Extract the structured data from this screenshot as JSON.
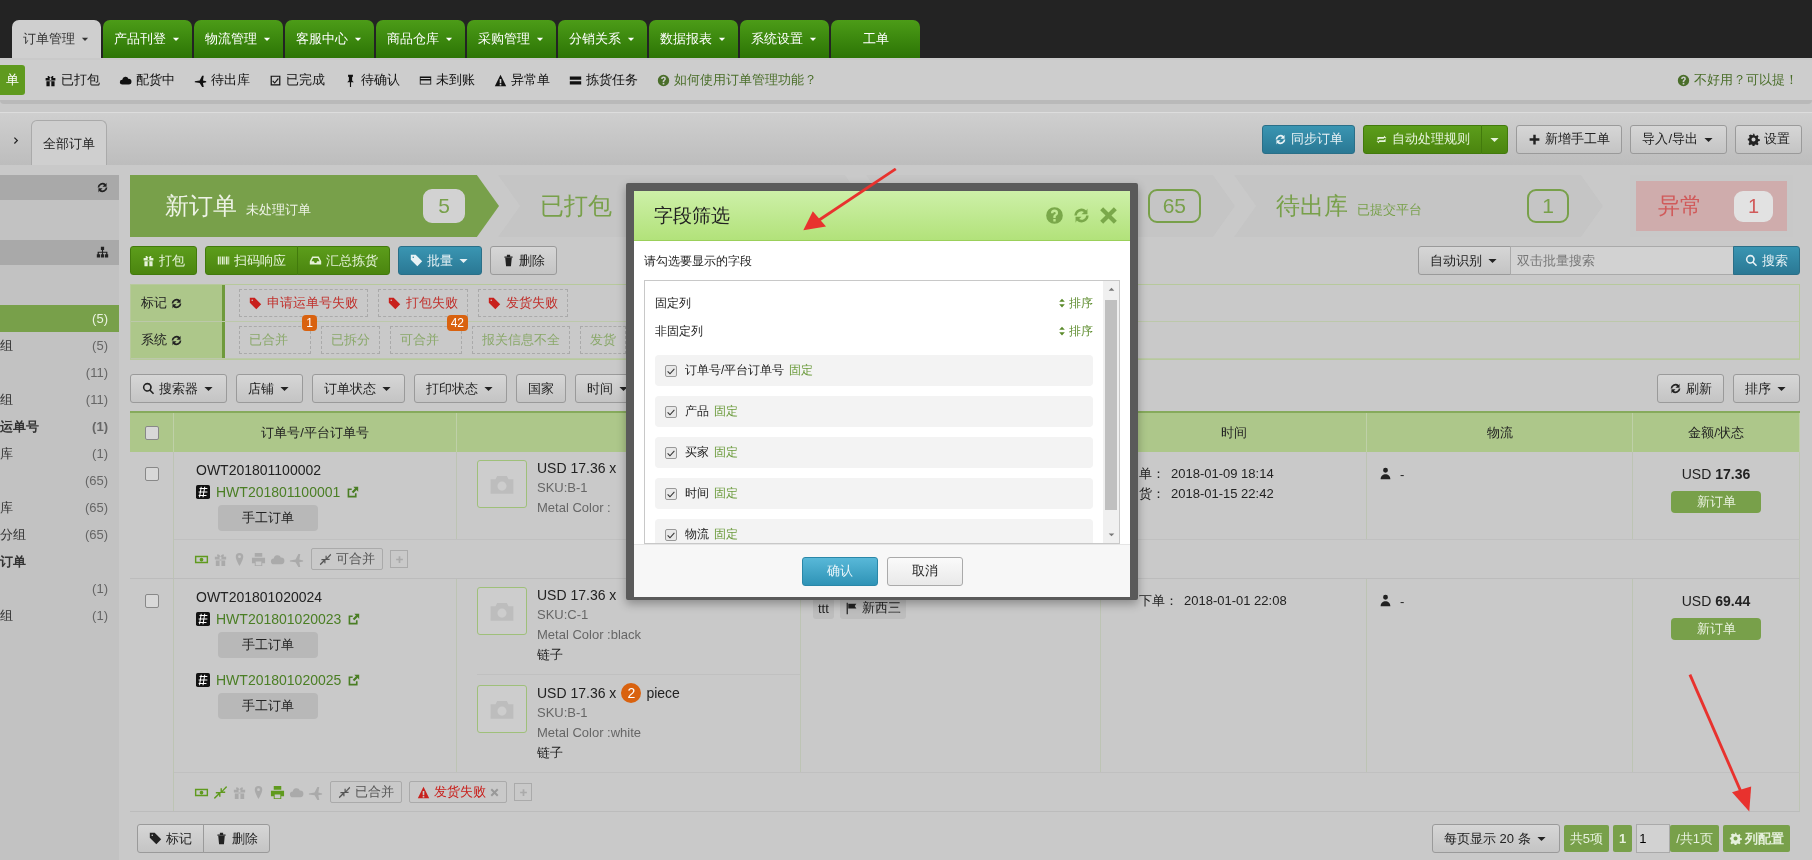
{
  "top_nav": {
    "tabs": [
      {
        "label": "订单管理",
        "selected": true,
        "dropdown": true
      },
      {
        "label": "产品刊登",
        "selected": false,
        "dropdown": true
      },
      {
        "label": "物流管理",
        "selected": false,
        "dropdown": true
      },
      {
        "label": "客服中心",
        "selected": false,
        "dropdown": true
      },
      {
        "label": "商品仓库",
        "selected": false,
        "dropdown": true
      },
      {
        "label": "采购管理",
        "selected": false,
        "dropdown": true
      },
      {
        "label": "分销关系",
        "selected": false,
        "dropdown": true
      },
      {
        "label": "数据报表",
        "selected": false,
        "dropdown": true
      },
      {
        "label": "系统设置",
        "selected": false,
        "dropdown": true
      },
      {
        "label": "工单",
        "selected": false,
        "dropdown": false
      }
    ]
  },
  "sub_nav": {
    "items": [
      {
        "label": "单",
        "selected": true
      },
      {
        "label": "已打包",
        "selected": false
      },
      {
        "label": "配货中",
        "selected": false
      },
      {
        "label": "待出库",
        "selected": false
      },
      {
        "label": "已完成",
        "selected": false
      },
      {
        "label": "待确认",
        "selected": false
      },
      {
        "label": "未到账",
        "selected": false
      },
      {
        "label": "异常单",
        "selected": false
      },
      {
        "label": "拣货任务",
        "selected": false
      }
    ],
    "help_link": "如何使用订单管理功能？",
    "feedback_link": "不好用？可以提！"
  },
  "breadcrumb": {
    "tab": "全部订单"
  },
  "header_buttons": [
    {
      "label": "同步订单",
      "kind": "blue"
    },
    {
      "label": "自动处理规则",
      "kind": "green-split"
    },
    {
      "label": "新增手工单",
      "kind": "default"
    },
    {
      "label": "导入/导出",
      "kind": "dropdown"
    },
    {
      "label": "设置",
      "kind": "default"
    }
  ],
  "sidebar": {
    "items": [
      {
        "kind": "header"
      },
      {
        "kind": "header"
      },
      {
        "kind": "item",
        "count": "(5)",
        "selected": true
      },
      {
        "kind": "item",
        "label": "组",
        "count": "(5)",
        "selected": false
      },
      {
        "kind": "item",
        "count": "(11)",
        "selected": false
      },
      {
        "kind": "item",
        "label": "组",
        "count": "(11)",
        "selected": false
      },
      {
        "kind": "group",
        "label": "运单号",
        "count": "(1)",
        "selected": false
      },
      {
        "kind": "item",
        "label": "库",
        "count": "(1)",
        "selected": false
      },
      {
        "kind": "item",
        "count": "(65)",
        "selected": false
      },
      {
        "kind": "item",
        "label": "库",
        "count": "(65)",
        "selected": false
      },
      {
        "kind": "item",
        "label": "分组",
        "count": "(65)",
        "selected": false
      },
      {
        "kind": "group",
        "label": "订单",
        "selected": false
      },
      {
        "kind": "item",
        "count": "(1)",
        "selected": false
      },
      {
        "kind": "item",
        "label": "组",
        "count": "(1)",
        "selected": false
      }
    ]
  },
  "status_steps": [
    {
      "title": "新订单",
      "subtitle": "未处理订单",
      "count": "5",
      "selected": true
    },
    {
      "title": "已打包",
      "selected": false
    },
    {
      "count": "65",
      "selected": false
    },
    {
      "title": "待出库",
      "subtitle": "已提交平台",
      "count": "1",
      "selected": false
    }
  ],
  "exception": {
    "title": "异常",
    "count": "1"
  },
  "action_buttons": [
    {
      "label": "打包",
      "kind": "green"
    },
    {
      "label": "扫码响应",
      "kind": "green-left"
    },
    {
      "label": "汇总拣货",
      "kind": "green-right"
    },
    {
      "label": "批量",
      "kind": "blue-dropdown"
    },
    {
      "label": "删除",
      "kind": "default"
    }
  ],
  "search": {
    "mode": "自动识别",
    "placeholder": "双击批量搜索",
    "button": "搜索"
  },
  "tag_rows": [
    {
      "label": "标记",
      "tags": [
        {
          "label": "申请运单号失败",
          "kind": "flag"
        },
        {
          "label": "打包失败",
          "kind": "flag"
        },
        {
          "label": "发货失败",
          "kind": "flag"
        }
      ]
    },
    {
      "label": "系统",
      "tags": [
        {
          "label": "已合并",
          "count": "1",
          "kind": "plain"
        },
        {
          "label": "已拆分",
          "kind": "plain"
        },
        {
          "label": "可合并",
          "count": "42",
          "kind": "plain"
        },
        {
          "label": "报关信息不全",
          "kind": "plain"
        },
        {
          "label": "发货",
          "kind": "plain"
        }
      ]
    }
  ],
  "filters": [
    {
      "label": "搜索器",
      "dropdown": true
    },
    {
      "label": "店铺",
      "dropdown": true
    },
    {
      "label": "订单状态",
      "dropdown": true
    },
    {
      "label": "打印状态",
      "dropdown": true
    },
    {
      "label": "国家",
      "dropdown": false
    },
    {
      "label": "时间",
      "dropdown": true
    }
  ],
  "refresh_button": "刷新",
  "sort_button": "排序",
  "table": {
    "header_checked": false,
    "columns": [
      {
        "label": "订单号/平台订单号"
      },
      {},
      {},
      {
        "label": "时间"
      },
      {
        "label": "物流"
      },
      {
        "label": "金额/状态"
      }
    ],
    "rows": [
      {
        "checked": false,
        "order_no": "OWT201801100002",
        "platform_orders": [
          {
            "no": "HWT201801100001",
            "tag": "手工订单"
          }
        ],
        "products": [
          {
            "price": "USD 17.36 x",
            "sku": "SKU:B-1",
            "variant": "Metal Color :"
          }
        ],
        "times": [
          {
            "label": "单：",
            "value": "2018-01-09 18:14"
          },
          {
            "label": "货：",
            "value": "2018-01-15 22:42"
          }
        ],
        "logistics": "-",
        "currency": "USD",
        "amount": "17.36",
        "status": "新订单",
        "icons": [
          {
            "kind": "money",
            "active": true
          },
          {
            "kind": "gift",
            "active": false
          },
          {
            "kind": "marker",
            "active": false
          },
          {
            "kind": "print",
            "active": false
          },
          {
            "kind": "cloud",
            "active": false
          },
          {
            "kind": "plane",
            "active": false
          }
        ],
        "tags": [
          {
            "label": "可合并",
            "kind": "merge"
          }
        ]
      },
      {
        "checked": false,
        "order_no": "OWT201801020024",
        "platform_orders": [
          {
            "no": "HWT201801020023",
            "tag": "手工订单"
          },
          {
            "no": "HWT201801020025",
            "tag": "手工订单"
          }
        ],
        "products": [
          {
            "price": "USD 17.36 x",
            "sku": "SKU:C-1",
            "variant": "Metal Color :black",
            "name": "链子"
          },
          {
            "price": "USD 17.36 x",
            "qty": "2",
            "unit": "piece",
            "sku": "SKU:B-1",
            "variant": "Metal Color :white",
            "name": "链子"
          }
        ],
        "buyer": {
          "name": "ttt",
          "country": "新西三"
        },
        "times": [
          {
            "label": "下单：",
            "value": "2018-01-01 22:08"
          }
        ],
        "logistics": "-",
        "currency": "USD",
        "amount": "69.44",
        "status": "新订单",
        "icons": [
          {
            "kind": "money",
            "active": true
          },
          {
            "kind": "compress",
            "active": true
          },
          {
            "kind": "gift",
            "active": false
          },
          {
            "kind": "marker",
            "active": false
          },
          {
            "kind": "print",
            "active": true
          },
          {
            "kind": "cloud",
            "active": false
          },
          {
            "kind": "plane",
            "active": false
          }
        ],
        "tags": [
          {
            "label": "已合并",
            "kind": "merge"
          },
          {
            "label": "发货失败",
            "kind": "error"
          }
        ]
      }
    ]
  },
  "bottom_actions": [
    {
      "label": "标记"
    },
    {
      "label": "删除"
    }
  ],
  "pager": {
    "page_size": "每页显示 20 条",
    "total": "共5项",
    "current": "1",
    "page_input": "1",
    "pages": "/共1页",
    "config": "列配置"
  },
  "modal": {
    "title": "字段筛选",
    "prompt": "请勾选要显示的字段",
    "sections": [
      {
        "label": "固定列",
        "sort": "排序"
      },
      {
        "label": "非固定列",
        "sort": "排序"
      }
    ],
    "fields": [
      {
        "label": "订单号/平台订单号",
        "tag": "固定",
        "checked": true
      },
      {
        "label": "产品",
        "tag": "固定",
        "checked": true
      },
      {
        "label": "买家",
        "tag": "固定",
        "checked": true
      },
      {
        "label": "时间",
        "tag": "固定",
        "checked": true
      },
      {
        "label": "物流",
        "tag": "固定",
        "checked": true
      }
    ],
    "confirm": "确认",
    "cancel": "取消"
  }
}
